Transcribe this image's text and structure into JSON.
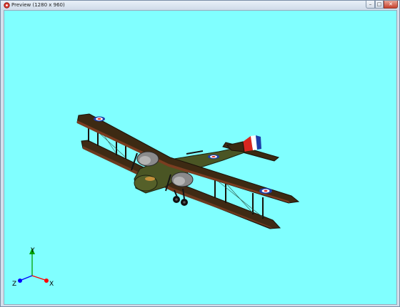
{
  "window": {
    "title": "Preview (1280 x 960)",
    "app_icon": "red-circle-app-icon",
    "controls": {
      "minimize_icon": "minimize-icon",
      "maximize_icon": "maximize-icon",
      "close_icon": "close-icon"
    }
  },
  "viewport": {
    "background_color": "#80ffff",
    "model": "biplane-3d-model",
    "axes": {
      "y_label": "Y",
      "z_label": "Z",
      "x_label": "X",
      "y_color": "#00a000",
      "z_color": "#0000ff",
      "x_color": "#ff0000"
    }
  }
}
